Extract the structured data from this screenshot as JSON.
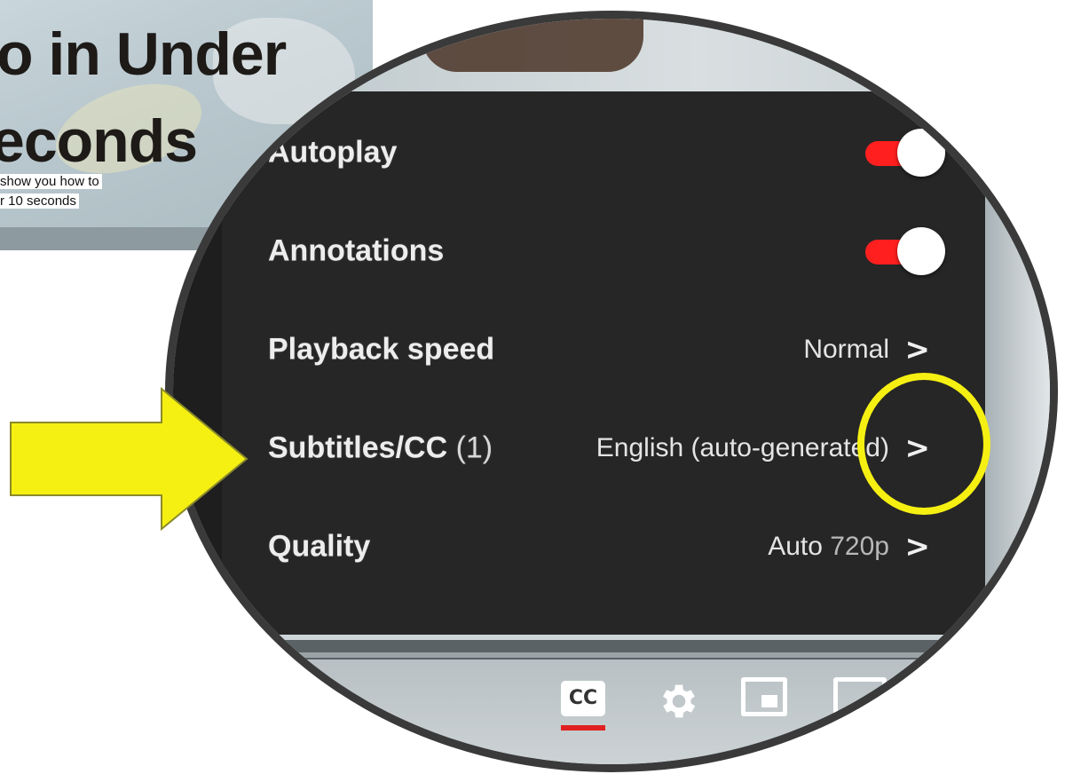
{
  "thumbnail": {
    "title_line1": "o in Under",
    "title_line2": "econds",
    "caption_line1": "show you how to",
    "caption_line2": "r 10 seconds"
  },
  "settings_menu": {
    "items": [
      {
        "label": "Autoplay",
        "type": "toggle",
        "state": "on"
      },
      {
        "label": "Annotations",
        "type": "toggle",
        "state": "on"
      },
      {
        "label": "Playback speed",
        "type": "submenu",
        "value": "Normal"
      },
      {
        "label": "Subtitles/CC",
        "count": "(1)",
        "type": "submenu",
        "value": "English (auto-generated)"
      },
      {
        "label": "Quality",
        "type": "submenu",
        "value": "Auto",
        "value_detail": "720p"
      }
    ],
    "chevron": ">"
  },
  "player_controls": {
    "cc_label": "CC",
    "icons": [
      "cc-icon",
      "gear-icon",
      "miniplayer-icon",
      "theater-mode-icon"
    ]
  },
  "colors": {
    "toggle_on": "#ff1f1f",
    "highlight": "#f5f012",
    "arrow": "#f5f012",
    "panel_bg": "#262626"
  }
}
